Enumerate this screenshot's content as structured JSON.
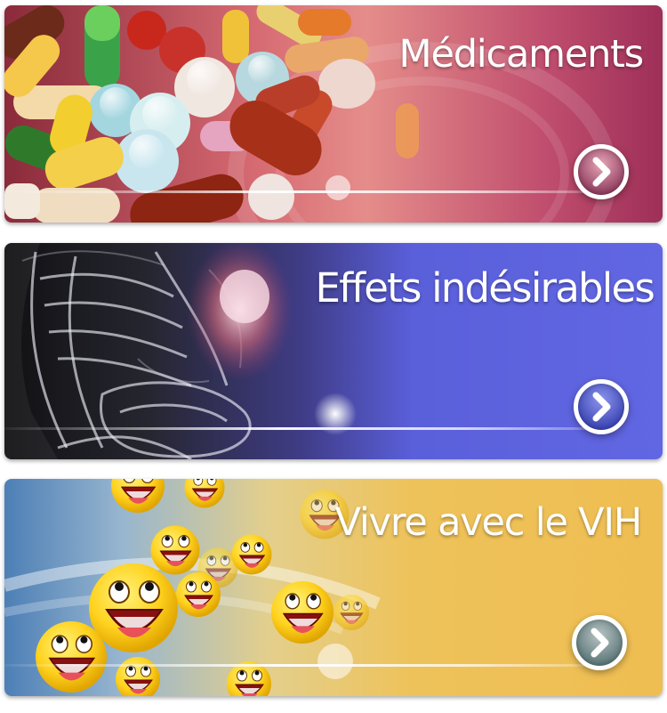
{
  "cards": [
    {
      "title": "Médicaments",
      "icon": "chevron-right-icon"
    },
    {
      "title": "Effets indésirables",
      "icon": "chevron-right-icon"
    },
    {
      "title": "Vivre avec le VIH",
      "icon": "chevron-right-icon"
    }
  ],
  "colors": {
    "medicaments_accent": "#c04e6e",
    "effets_accent": "#5a5fda",
    "vih_accent": "#efbe52"
  }
}
